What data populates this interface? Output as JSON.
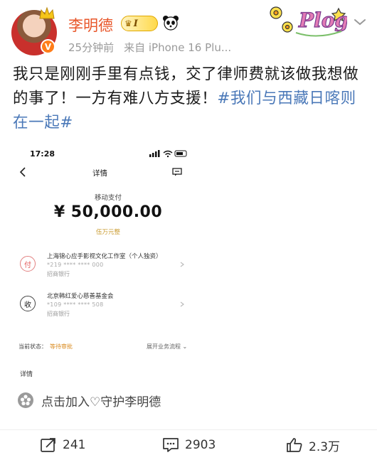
{
  "post": {
    "author": "李明德",
    "member_level": "I",
    "time": "25分钟前",
    "source": "来自 iPhone 16 Plu...",
    "sticker_text": "Plog",
    "text_main": "我只是刚刚手里有点钱，交了律师费就该做我想做的事了！一方有难八方支援！",
    "hashtag": "#我们与西藏日喀则在一起#"
  },
  "screenshot": {
    "status_time": "17:28",
    "nav_title": "详情",
    "pay_method": "移动支付",
    "amount": "¥ 50,000.00",
    "amount_words": "伍万元整",
    "payer": {
      "mark": "付",
      "name": "上海锦心应手影视文化工作室（个人独资）",
      "account": "*219 **** **** 000",
      "bank": "招商银行"
    },
    "payee": {
      "mark": "收",
      "name": "北京韩红爱心慈善基金会",
      "account": "*109 **** **** 508",
      "bank": "招商银行"
    },
    "status_label": "当前状态：",
    "status_value": "等待审批",
    "flow_link": "展开业务流程",
    "detail_label": "详情"
  },
  "join_text": "点击加入♡守护李明德",
  "actions": {
    "repost_count": "241",
    "comment_count": "2903",
    "like_count": "2.3万"
  },
  "colors": {
    "username": "#e8562a",
    "hashtag": "#4a78b8",
    "status": "#d98a1e",
    "amount_words": "#c99a2e"
  },
  "icons": [
    "verified-icon",
    "crown-icon",
    "panda-icon",
    "more-icon",
    "back-icon",
    "message-icon",
    "chevron-right-icon",
    "fan-club-icon",
    "repost-icon",
    "comment-icon",
    "like-icon"
  ]
}
